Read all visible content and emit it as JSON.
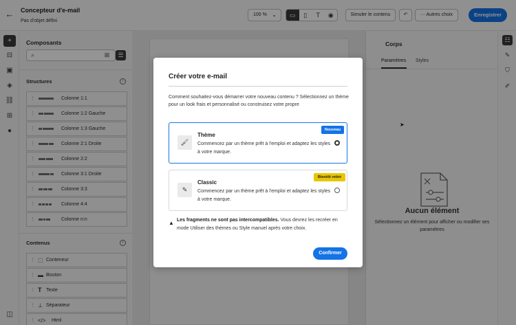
{
  "header": {
    "title": "Concepteur d'e-mail",
    "subtitle": "Pas d'objet défini",
    "zoom": "100 %",
    "simulate_label": "Simuler le contenu",
    "more_label": "Autres choix",
    "save_label": "Enregistrer"
  },
  "components": {
    "title": "Composants",
    "structures_title": "Structures",
    "structures": [
      "Colonne 1:1",
      "Colonne 1:2 Gauche",
      "Colonne 1:3 Gauche",
      "Colonne 2:1 Droite",
      "Colonne 2:2",
      "Colonne 3:1 Droite",
      "Colonne 3:3",
      "Colonne 4:4",
      "Colonne n:n"
    ],
    "contents_title": "Contenus",
    "contents": [
      "Conteneur",
      "Bouton",
      "Texte",
      "Séparateur",
      "Html"
    ]
  },
  "right_panel": {
    "title": "Corps",
    "tabs": [
      "Paramètres",
      "Styles"
    ],
    "empty_title": "Aucun élément",
    "empty_desc": "Sélectionnez un élément pour afficher ou modifier ses paramètres"
  },
  "modal": {
    "title": "Créer votre e-mail",
    "intro": "Comment souhaitez-vous démarrer votre nouveau contenu ? Sélectionnez un thème pour un look frais et personnalisé ou construisez votre propre",
    "cards": [
      {
        "title": "Thème",
        "desc": "Commencez par un thème prêt à l'emploi et adaptez les styles à votre marque.",
        "badge": "Nouveau"
      },
      {
        "title": "Classic",
        "desc": "Commencez par un thème prêt à l'emploi et adaptez les styles à votre marque.",
        "badge": "Bientôt retiré"
      }
    ],
    "warning_bold": "Les fragments ne sont pas intercompatibles.",
    "warning_rest": " Vous devrez les recréer en mode Utiliser des thèmes ou Style manuel après votre choix.",
    "confirm_label": "Confirmer"
  },
  "colors": {
    "accent": "#1473e6",
    "badge_warning": "#e8c600"
  },
  "icons": [
    "back-arrow-icon",
    "desktop-icon",
    "mobile-icon",
    "text-icon",
    "eye-icon",
    "undo-icon",
    "more-icon",
    "search-icon",
    "grid-view-icon",
    "list-view-icon",
    "info-icon",
    "brush-icon",
    "edit-icon",
    "alert-icon"
  ]
}
